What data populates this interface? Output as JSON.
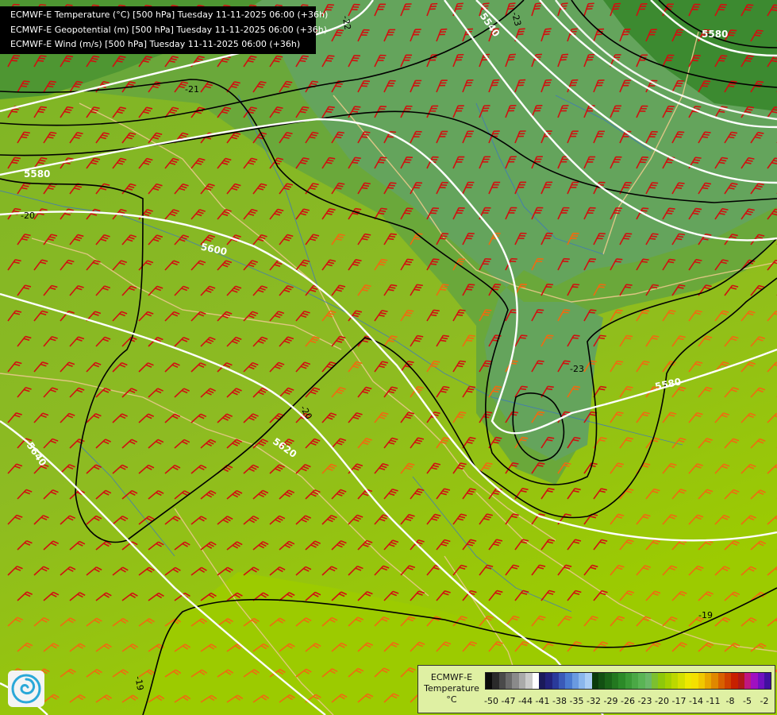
{
  "titles": [
    "ECMWF-E Temperature (°C) [500 hPa] Tuesday 11-11-2025 06:00 (+36h)",
    "ECMWF-E Geopotential (m) [500 hPa] Tuesday 11-11-2025 06:00 (+36h)",
    "ECMWF-E Wind (m/s) [500 hPa] Tuesday 11-11-2025 06:00 (+36h)"
  ],
  "geopotential_labels": [
    "5580",
    "5540",
    "5580",
    "5600",
    "5580",
    "5620",
    "5640"
  ],
  "temperature_labels": [
    "-22",
    "-23",
    "-21",
    "-20",
    "-20",
    "-23",
    "-19",
    "-19"
  ],
  "legend": {
    "title_lines": [
      "ECMWF-E",
      "Temperature",
      "°C"
    ],
    "ticks": [
      "-50",
      "-47",
      "-44",
      "-41",
      "-38",
      "-35",
      "-32",
      "-29",
      "-26",
      "-23",
      "-20",
      "-17",
      "-14",
      "-11",
      "-8",
      "-5",
      "-2"
    ],
    "colors": [
      "#0a0a0a",
      "#2a2a2a",
      "#4a4a4a",
      "#6a6a6a",
      "#8a8a8a",
      "#aaaaaa",
      "#cacaca",
      "#ffffff",
      "#1a1a5a",
      "#22227a",
      "#2a3a9a",
      "#3a5ab8",
      "#4a7ad0",
      "#6a9ae0",
      "#8ab6ec",
      "#aacdf4",
      "#0a3a0a",
      "#125012",
      "#1a6418",
      "#23781f",
      "#2c8a28",
      "#3a9a35",
      "#4aa845",
      "#5ab455",
      "#6ab868",
      "#7cc030",
      "#8ec80a",
      "#a4d000",
      "#bcd800",
      "#d4e000",
      "#eee800",
      "#f4e000",
      "#f0c800",
      "#e8a800",
      "#e08800",
      "#d86000",
      "#d04000",
      "#c82000",
      "#b01818",
      "#c01880",
      "#a010c0",
      "#7010c0",
      "#4010a0"
    ]
  },
  "colors": {
    "wind_red": "#d01010",
    "wind_orange": "#f06a10",
    "contour_height": "#ffffff",
    "contour_temp": "#000000",
    "border": "#e8c98a",
    "river": "#3a72c8"
  }
}
